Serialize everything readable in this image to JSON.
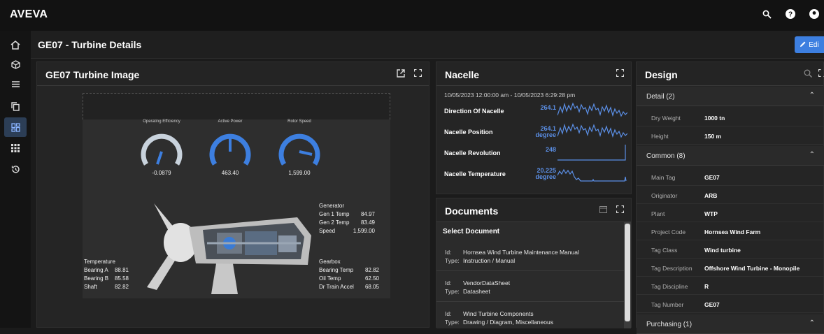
{
  "app": {
    "title": "AVEVA"
  },
  "topbar": {
    "icons": [
      "search-icon",
      "help-icon",
      "user-icon"
    ]
  },
  "rail": {
    "items": [
      "home-icon",
      "cube-icon",
      "list-icon",
      "copy-icon",
      "dashboard-icon",
      "apps-grid-icon",
      "history-icon"
    ],
    "active_index": 4
  },
  "page": {
    "title": "GE07 - Turbine Details",
    "edit_label": "Edi"
  },
  "image_panel": {
    "title": "GE07 Turbine Image",
    "gauges": [
      {
        "label": "Operating Efficiency",
        "value": "-0.0879"
      },
      {
        "label": "Active Power",
        "value": "463.40"
      },
      {
        "label": "Rotor Speed",
        "value": "1,599.00"
      }
    ],
    "generator": {
      "title": "Generator",
      "rows": [
        {
          "name": "Gen 1 Temp",
          "value": "84.97"
        },
        {
          "name": "Gen 2 Temp",
          "value": "83.49"
        },
        {
          "name": "Speed",
          "value": "1,599.00"
        }
      ]
    },
    "temperature": {
      "title": "Temperature",
      "rows": [
        {
          "name": "Bearing A",
          "value": "88.81"
        },
        {
          "name": "Bearing B",
          "value": "85.58"
        },
        {
          "name": "Shaft",
          "value": "82.82"
        }
      ]
    },
    "gearbox": {
      "title": "Gearbox",
      "rows": [
        {
          "name": "Bearing Temp",
          "value": "82.82"
        },
        {
          "name": "Oil Temp",
          "value": "62.50"
        },
        {
          "name": "Dr Train Accel",
          "value": "68.05"
        }
      ]
    }
  },
  "nacelle_panel": {
    "title": "Nacelle",
    "range": "10/05/2023 12:00:00 am - 10/05/2023 6:29:28 pm",
    "rows": [
      {
        "name": "Direction Of Nacelle",
        "value": "264.1",
        "unit": ""
      },
      {
        "name": "Nacelle Position",
        "value": "264.1",
        "unit": "degree"
      },
      {
        "name": "Nacelle Revolution",
        "value": "248",
        "unit": ""
      },
      {
        "name": "Nacelle Temperature",
        "value": "20.225",
        "unit": "degree"
      }
    ],
    "accent": "#5b8fe6"
  },
  "documents_panel": {
    "title": "Documents",
    "select_label": "Select Document",
    "id_label": "Id:",
    "type_label": "Type:",
    "items": [
      {
        "id": "Hornsea Wind Turbine Maintenance Manual",
        "type": "Instruction / Manual"
      },
      {
        "id": "VendorDataSheet",
        "type": "Datasheet"
      },
      {
        "id": "Wind Turbine Components",
        "type": "Drawing / Diagram, Miscellaneous"
      }
    ]
  },
  "design_panel": {
    "title": "Design",
    "sections": [
      {
        "title": "Detail (2)",
        "rows": [
          {
            "key": "Dry Weight",
            "value": "1000 tn"
          },
          {
            "key": "Height",
            "value": "150 m"
          }
        ]
      },
      {
        "title": "Common (8)",
        "rows": [
          {
            "key": "Main Tag",
            "value": "GE07"
          },
          {
            "key": "Originator",
            "value": "ARB"
          },
          {
            "key": "Plant",
            "value": "WTP"
          },
          {
            "key": "Project Code",
            "value": "Hornsea Wind Farm"
          },
          {
            "key": "Tag Class",
            "value": "Wind turbine"
          },
          {
            "key": "Tag Description",
            "value": "Offshore Wind Turbine - Monopile"
          },
          {
            "key": "Tag Discipline",
            "value": "R"
          },
          {
            "key": "Tag Number",
            "value": "GE07"
          }
        ]
      },
      {
        "title": "Purchasing (1)",
        "rows": []
      }
    ]
  }
}
